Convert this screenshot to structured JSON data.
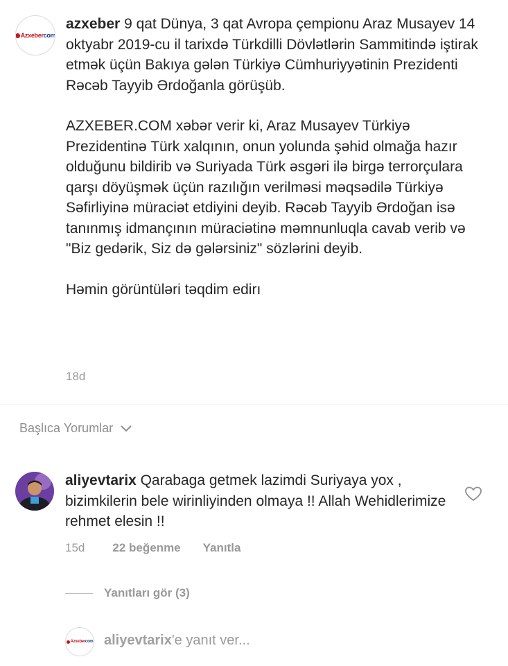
{
  "post": {
    "username": "azxeber",
    "brand": {
      "part1": "Azxeber",
      "part2": "com"
    },
    "caption_first": "9 qat Dünya, 3 qat Avropa çempionu Araz Musayev 14 oktyabr 2019-cu il tarixdə Türkdilli Dövlətlərin Sammitində iştirak etmək üçün Bakıya gələn Türkiyə Cümhuriyyətinin Prezidenti Rəcəb Tayyib Ərdoğanla görüşüb.",
    "caption_second": "AZXEBER.COM xəbər verir ki, Araz Musayev Türkiyə Prezidentinə Türk xalqının, onun yolunda şəhid olmağa hazır olduğunu bildirib və Suriyada Türk əsgəri ilə birgə terrorçulara qarşı döyüşmək üçün razılığın verilməsi məqsədilə Türkiyə Səfirliyinə müraciət etdiyini deyib. Rəcəb Tayyib Ərdoğan isə tanınmış idmançının müraciətinə məmnunluqla cavab verib və \"Biz gedərik, Siz də gələrsiniz\" sözlərini deyib.",
    "caption_third": "Həmin görüntüləri təqdim edirı",
    "time": "18d"
  },
  "comments_header": {
    "label": "Başlıca Yorumlar"
  },
  "comment": {
    "username": "aliyevtarix",
    "text": "Qarabaga getmek lazimdi Suriyaya yox , bizimkilerin bele wirinliyinden olmaya !! Allah Wehidlerimize rehmet elesin !!",
    "time": "15d",
    "likes": "22 beğenme",
    "reply_label": "Yanıtla",
    "view_replies": "Yanıtları gör (3)"
  },
  "reply_input": {
    "mention": "aliyevtarix",
    "placeholder_rest": "'e yanıt ver..."
  }
}
